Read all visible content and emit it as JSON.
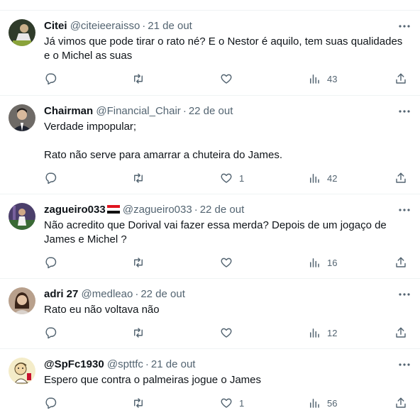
{
  "tweets": [
    {
      "name": "Citei",
      "handle": "@citeieeraisso",
      "dot": "·",
      "time": "21 de out",
      "lines": [
        "Já vimos que pode tirar o rato né? E o Nestor é aquilo, tem suas qualidades",
        "e o Michel as suas"
      ],
      "likes": "",
      "views": "43",
      "avatar": "avatar-citei"
    },
    {
      "name": "Chairman",
      "handle": "@Financial_Chair",
      "dot": "·",
      "time": "22 de out",
      "lines": [
        "Verdade impopular;",
        "",
        "Rato não serve para amarrar a chuteira do James."
      ],
      "likes": "1",
      "views": "42",
      "avatar": "avatar-chairman"
    },
    {
      "name": "zagueiro033",
      "handle": "@zagueiro033",
      "dot": "·",
      "time": "22 de out",
      "lines": [
        "Não acredito que Dorival vai fazer essa merda? Depois de um jogaço de",
        "James e Michel ?"
      ],
      "likes": "",
      "views": "16",
      "avatar": "avatar-zagueiro",
      "flag_icon": "flag-icon"
    },
    {
      "name": "adri 27",
      "handle": "@medleao",
      "dot": "·",
      "time": "22 de out",
      "lines": [
        "Rato eu não voltava não"
      ],
      "likes": "",
      "views": "12",
      "avatar": "avatar-adri"
    },
    {
      "name": "@SpFc1930",
      "handle": "@spttfc",
      "dot": "·",
      "time": "21 de out",
      "lines": [
        "Espero que contra o palmeiras jogue o James"
      ],
      "likes": "1",
      "views": "56",
      "avatar": "avatar-spfc"
    }
  ],
  "icons": {
    "reply": "reply-icon",
    "retweet": "retweet-icon",
    "like": "heart-icon",
    "views": "views-icon",
    "share": "share-icon",
    "more": "more-icon"
  },
  "colors": {
    "text": "#0f1419",
    "secondary": "#536471",
    "divider": "#eff3f4"
  }
}
